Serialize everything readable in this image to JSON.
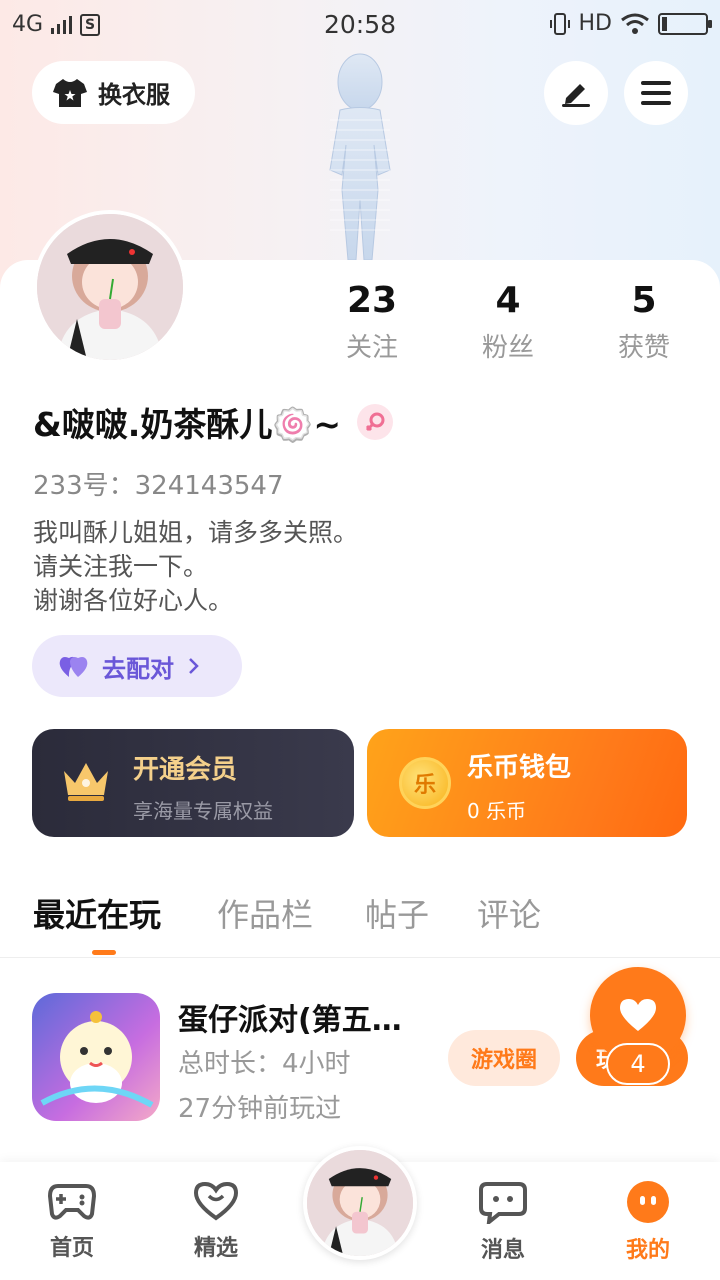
{
  "status_bar": {
    "network": "4G",
    "sim": "S",
    "time": "20:58",
    "hd": "HD",
    "battery_level": 0.1
  },
  "header": {
    "change_clothes_label": "换衣服",
    "edit_icon": "pen-icon",
    "menu_icon": "menu-icon"
  },
  "profile": {
    "nickname": "&啵啵.奶茶酥儿🍥~",
    "uid": "233号：324143547",
    "bio": [
      "我叫酥儿姐姐，请多多关照。",
      "请关注我一下。",
      "谢谢各位好心人。"
    ],
    "gender": "female",
    "stats": [
      {
        "value": "23",
        "label": "关注"
      },
      {
        "value": "4",
        "label": "粉丝"
      },
      {
        "value": "5",
        "label": "获赞"
      }
    ],
    "match_label": "去配对"
  },
  "cards": {
    "vip_title": "开通会员",
    "vip_sub": "享海量专属权益",
    "wallet_title": "乐币钱包",
    "wallet_sub": "0 乐币",
    "coin_glyph": "乐"
  },
  "tabs": [
    "最近在玩",
    "作品栏",
    "帖子",
    "评论"
  ],
  "games": [
    {
      "name": "蛋仔派对(第五…",
      "play_time": "总时长：4小时",
      "last_played": "27分钟前玩过",
      "circle_label": "游戏圈",
      "play_label": "玩"
    }
  ],
  "float_like": {
    "count": "4"
  },
  "bottom_nav": [
    {
      "label": "首页",
      "icon": "gamepad-icon"
    },
    {
      "label": "精选",
      "icon": "heart-smile-icon"
    },
    {
      "label": "",
      "icon": "avatar"
    },
    {
      "label": "消息",
      "icon": "chat-icon"
    },
    {
      "label": "我的",
      "icon": "profile-dots-icon"
    }
  ],
  "colors": {
    "accent": "#ff7a1a",
    "vip_gold": "#f4d08b",
    "match_purple": "#6a57d8"
  }
}
